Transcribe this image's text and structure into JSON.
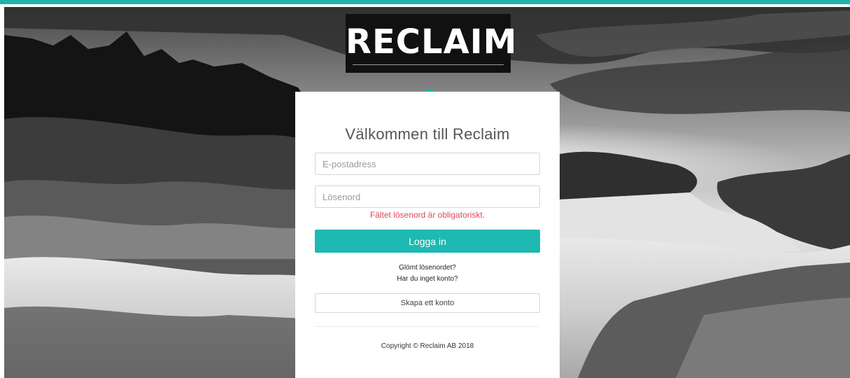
{
  "brand": {
    "logo_text": "RECLAIM",
    "accent_color": "#1fb3ad"
  },
  "login": {
    "heading": "Välkommen till Reclaim",
    "email_placeholder": "E-postadress",
    "password_placeholder": "Lösenord",
    "password_error": "Fältet lösenord är obligatoriskt.",
    "error_color": "#e0455a",
    "submit_label": "Logga in",
    "forgot_password": "Glömt lösenordet?",
    "no_account": "Har du inget konto?",
    "create_account": "Skapa ett konto"
  },
  "footer": {
    "copyright": "Copyright © Reclaim AB 2018"
  },
  "background": {
    "icon": "rocky-coast-landscape-photo"
  }
}
